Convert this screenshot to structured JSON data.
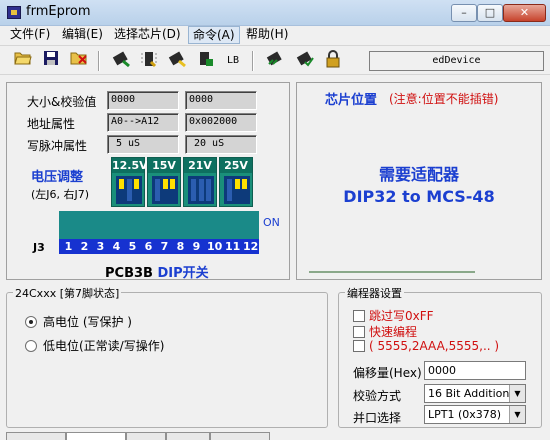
{
  "window": {
    "title": "frmEprom",
    "min_icon": "minimize-icon",
    "max_icon": "maximize-icon",
    "close_icon": "close-icon",
    "min_glyph": "–",
    "max_glyph": "□",
    "close_glyph": "✕"
  },
  "menu": {
    "items": [
      {
        "label": "文件(F)"
      },
      {
        "label": "编辑(E)"
      },
      {
        "label": "选择芯片(D)"
      },
      {
        "label": "命令(A)"
      },
      {
        "label": "帮助(H)"
      }
    ]
  },
  "toolbar": {
    "device_name": "edDevice",
    "lb_label": "LB"
  },
  "chip_info": {
    "size_checksum_label": "大小&校验值",
    "size_value": "0000",
    "checksum_value": "0000",
    "address_label": "地址属性",
    "address_range": "A0-->A12",
    "address_value": "0x002000",
    "pulse_label": "写脉冲属性",
    "pulse_value1": "5 uS",
    "pulse_value2": "20 uS"
  },
  "voltage": {
    "title": "电压调整",
    "subtitle": "(左J6, 右J7)",
    "switches": [
      {
        "label": "12.5V"
      },
      {
        "label": "15V"
      },
      {
        "label": "21V"
      },
      {
        "label": "25V"
      }
    ]
  },
  "dip": {
    "on_label": "ON",
    "connector_label": "J3",
    "numbers": [
      "1",
      "2",
      "3",
      "4",
      "5",
      "6",
      "7",
      "8",
      "9",
      "10",
      "11",
      "12"
    ],
    "caption_prefix": "PCB3B",
    "caption_suffix": "DIP开关"
  },
  "chip_position": {
    "title": "芯片位置",
    "note": "(注意:位置不能插错)",
    "adapter_line1": "需要适配器",
    "adapter_line2": "DIP32 to MCS-48"
  },
  "pin7": {
    "title": "24Cxxx [第7脚状态]",
    "option_high": "高电位 (写保护 )",
    "option_low": "低电位(正常读/写操作)",
    "selected": "high"
  },
  "programmer": {
    "title": "编程器设置",
    "skip_write": "跳过写0xFF",
    "fast_program": "快速编程",
    "addresses": "( 5555,2AAA,5555,.. )",
    "offset_label": "偏移量(Hex)",
    "offset_value": "0000",
    "checksum_label": "校验方式",
    "checksum_value": "16 Bit Addition",
    "port_label": "并口选择",
    "port_value": "LPT1 (0x378)"
  }
}
